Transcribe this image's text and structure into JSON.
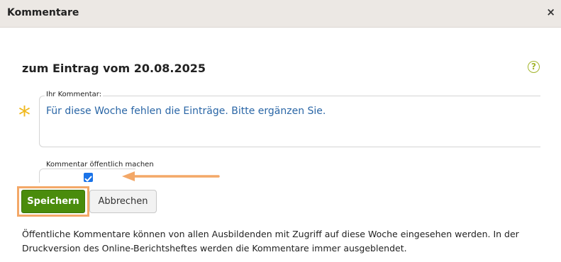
{
  "dialog": {
    "title": "Kommentare",
    "close_label": "×"
  },
  "main": {
    "heading": "zum Eintrag vom 20.08.2025",
    "help_label": "?",
    "comment": {
      "label": "Ihr Kommentar:",
      "value": "Für diese Woche fehlen die Einträge. Bitte ergänzen Sie.",
      "required_marker": "*"
    },
    "public": {
      "label": "Kommentar öffentlich machen",
      "checked": true
    },
    "buttons": {
      "save": "Speichern",
      "cancel": "Abbrechen"
    },
    "info_text": "Öffentliche Kommentare können von allen Ausbildenden mit Zugriff auf diese Woche eingesehen werden. In der Druckversion des Online-Berichtsheftes werden die Kommentare immer ausgeblendet."
  },
  "colors": {
    "save_button": "#4a8c0c",
    "annotation": "#f3a868",
    "required": "#f0b81c",
    "help": "#a3b52c",
    "comment_text": "#2a66a6"
  },
  "icons": {
    "close": "close-icon",
    "help": "help-icon",
    "arrow": "arrow-left-icon",
    "checkbox": "check-icon"
  }
}
